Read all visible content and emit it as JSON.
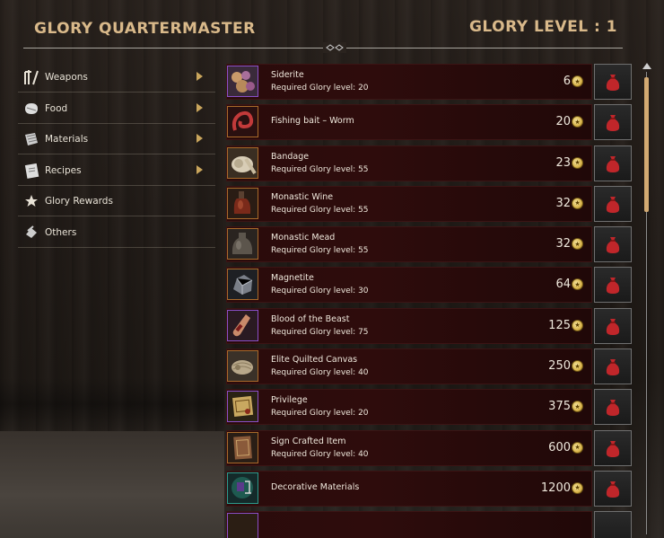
{
  "header": {
    "title": "GLORY QUARTERMASTER",
    "glory_level": "GLORY LEVEL : 1"
  },
  "sidebar": {
    "items": [
      {
        "label": "Weapons",
        "icon": "weapons-icon",
        "has_arrow": true
      },
      {
        "label": "Food",
        "icon": "food-icon",
        "has_arrow": true
      },
      {
        "label": "Materials",
        "icon": "materials-icon",
        "has_arrow": true
      },
      {
        "label": "Recipes",
        "icon": "recipes-icon",
        "has_arrow": true
      },
      {
        "label": "Glory Rewards",
        "icon": "glory-rewards-icon",
        "has_arrow": false
      },
      {
        "label": "Others",
        "icon": "others-icon",
        "has_arrow": false
      }
    ]
  },
  "items": [
    {
      "name": "Siderite",
      "requirement": "Required Glory level: 20",
      "price": "6",
      "icon": "siderite-icon",
      "frame": "purple"
    },
    {
      "name": "Fishing bait – Worm",
      "requirement": "",
      "price": "20",
      "icon": "worm-icon",
      "frame": "orange"
    },
    {
      "name": "Bandage",
      "requirement": "Required Glory level: 55",
      "price": "23",
      "icon": "bandage-icon",
      "frame": "orange"
    },
    {
      "name": "Monastic Wine",
      "requirement": "Required Glory level: 55",
      "price": "32",
      "icon": "wine-icon",
      "frame": "orange"
    },
    {
      "name": "Monastic Mead",
      "requirement": "Required Glory level: 55",
      "price": "32",
      "icon": "mead-icon",
      "frame": "orange"
    },
    {
      "name": "Magnetite",
      "requirement": "Required Glory level: 30",
      "price": "64",
      "icon": "magnetite-icon",
      "frame": "orange"
    },
    {
      "name": "Blood of the Beast",
      "requirement": "Required Glory level: 75",
      "price": "125",
      "icon": "potion-icon",
      "frame": "purple"
    },
    {
      "name": "Elite Quilted Canvas",
      "requirement": "Required Glory level: 40",
      "price": "250",
      "icon": "canvas-icon",
      "frame": "orange"
    },
    {
      "name": "Privilege",
      "requirement": "Required Glory level: 20",
      "price": "375",
      "icon": "privilege-icon",
      "frame": "purple"
    },
    {
      "name": "Sign Crafted Item",
      "requirement": "Required Glory level: 40",
      "price": "600",
      "icon": "book-icon",
      "frame": "orange"
    },
    {
      "name": "Decorative Materials",
      "requirement": "",
      "price": "1200",
      "icon": "decorative-icon",
      "frame": "teal"
    }
  ],
  "colors": {
    "accent_gold": "#d9b98a",
    "row_bg": "#2a0b0b",
    "buy_icon": "#c0262a"
  }
}
